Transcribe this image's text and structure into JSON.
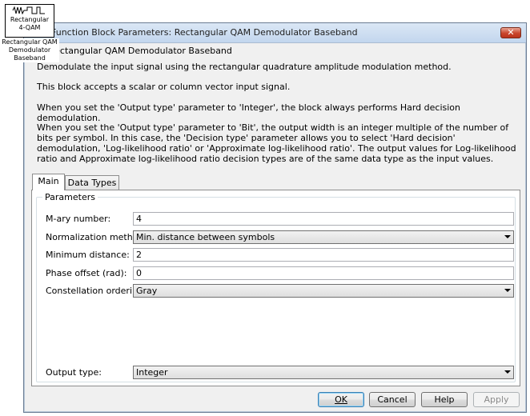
{
  "window": {
    "title": "Function Block Parameters: Rectangular QAM Demodulator Baseband",
    "close_glyph": "✕"
  },
  "block_icon": {
    "line1": "Rectangular",
    "line2": "4-QAM",
    "caption_line1": "Rectangular QAM",
    "caption_line2": "Demodulator",
    "caption_line3": "Baseband"
  },
  "header": {
    "block_name": "Rectangular QAM Demodulator Baseband"
  },
  "description": {
    "p1": "Demodulate the input signal using the rectangular quadrature amplitude modulation method.",
    "p2": "This block accepts a scalar or column vector input signal.",
    "p3": "When you set the 'Output type' parameter to 'Integer', the block always performs Hard decision demodulation.",
    "p4": "When you set the 'Output type' parameter to 'Bit', the output width is an integer multiple of the number of bits per symbol. In this case, the 'Decision type' parameter allows you to select 'Hard decision' demodulation, 'Log-likelihood ratio' or 'Approximate log-likelihood ratio'. The output values for Log-likelihood ratio and Approximate log-likelihood ratio decision types are of the same data type as the input values."
  },
  "tabs": [
    {
      "label": "Main",
      "active": true
    },
    {
      "label": "Data Types",
      "active": false
    }
  ],
  "parameters": {
    "group_label": "Parameters",
    "mary_label": "M-ary number:",
    "mary_value": "4",
    "norm_label": "Normalization method:",
    "norm_value": "Min. distance between symbols",
    "mindist_label": "Minimum distance:",
    "mindist_value": "2",
    "phase_label": "Phase offset (rad):",
    "phase_value": "0",
    "order_label": "Constellation ordering:",
    "order_value": "Gray",
    "outtype_label": "Output type:",
    "outtype_value": "Integer"
  },
  "buttons": {
    "ok": "OK",
    "cancel": "Cancel",
    "help": "Help",
    "apply": "Apply"
  },
  "colors": {
    "close_button": "#c9452c",
    "titlebar": "#c2d6ee",
    "default_button_border": "#3c7fb1"
  }
}
